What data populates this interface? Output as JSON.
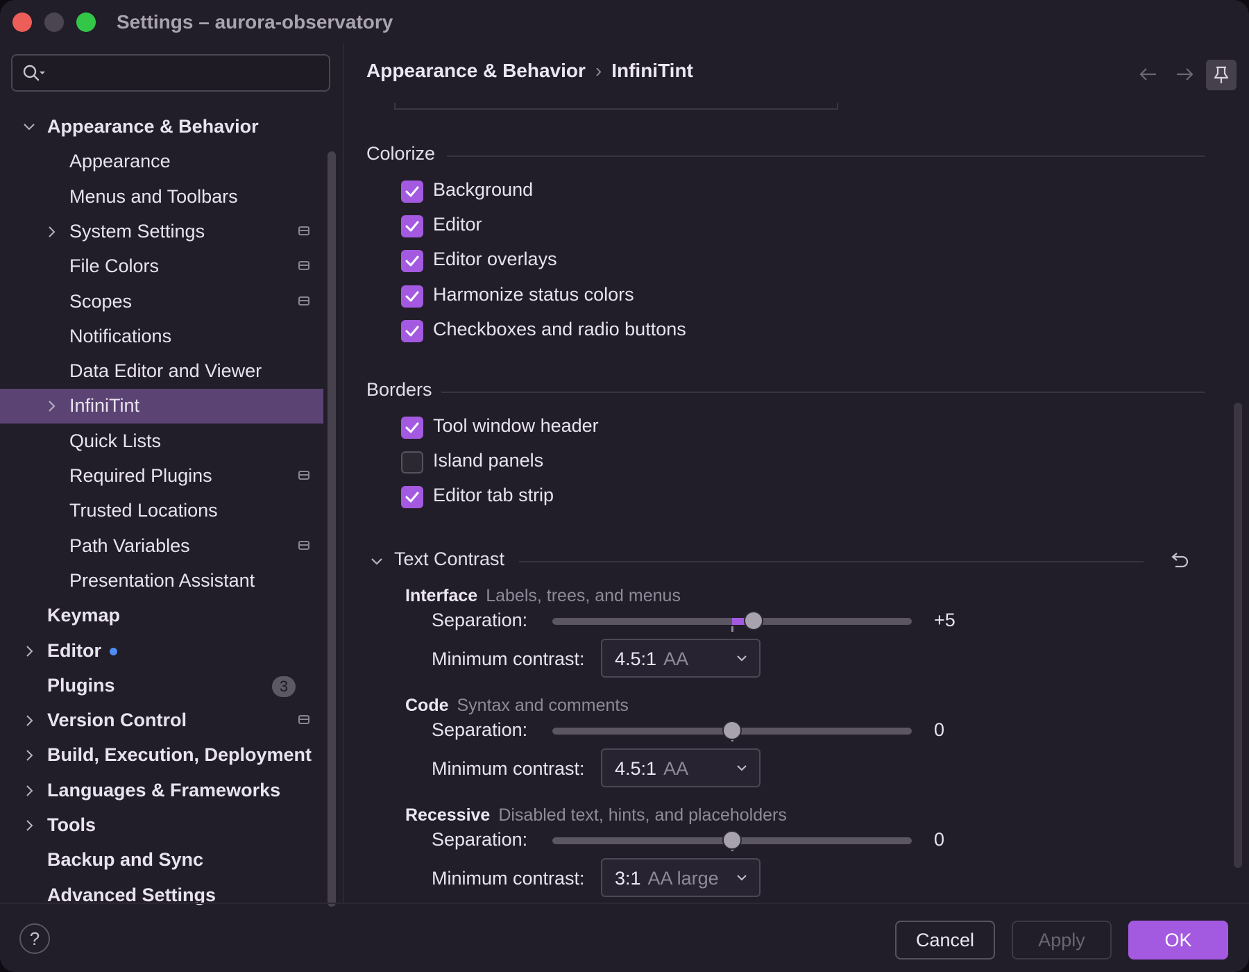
{
  "window": {
    "title": "Settings – aurora-observatory"
  },
  "search": {
    "placeholder": ""
  },
  "sidebar": {
    "items": [
      {
        "label": "Appearance & Behavior",
        "level": 0,
        "bold": true,
        "expanded": true
      },
      {
        "label": "Appearance",
        "level": 1
      },
      {
        "label": "Menus and Toolbars",
        "level": 1
      },
      {
        "label": "System Settings",
        "level": 1,
        "collapsed": true,
        "project_icon": true
      },
      {
        "label": "File Colors",
        "level": 1,
        "project_icon": true
      },
      {
        "label": "Scopes",
        "level": 1,
        "project_icon": true
      },
      {
        "label": "Notifications",
        "level": 1
      },
      {
        "label": "Data Editor and Viewer",
        "level": 1
      },
      {
        "label": "InfiniTint",
        "level": 1,
        "collapsed": true,
        "selected": true
      },
      {
        "label": "Quick Lists",
        "level": 1
      },
      {
        "label": "Required Plugins",
        "level": 1,
        "project_icon": true
      },
      {
        "label": "Trusted Locations",
        "level": 1
      },
      {
        "label": "Path Variables",
        "level": 1,
        "project_icon": true
      },
      {
        "label": "Presentation Assistant",
        "level": 1
      },
      {
        "label": "Keymap",
        "level": 0,
        "bold": true
      },
      {
        "label": "Editor",
        "level": 0,
        "bold": true,
        "collapsed": true,
        "modified_dot": true
      },
      {
        "label": "Plugins",
        "level": 0,
        "bold": true,
        "badge": "3"
      },
      {
        "label": "Version Control",
        "level": 0,
        "bold": true,
        "collapsed": true,
        "project_icon": true
      },
      {
        "label": "Build, Execution, Deployment",
        "level": 0,
        "bold": true,
        "collapsed": true
      },
      {
        "label": "Languages & Frameworks",
        "level": 0,
        "bold": true,
        "collapsed": true
      },
      {
        "label": "Tools",
        "level": 0,
        "bold": true,
        "collapsed": true
      },
      {
        "label": "Backup and Sync",
        "level": 0,
        "bold": true
      },
      {
        "label": "Advanced Settings",
        "level": 0,
        "bold": true
      }
    ]
  },
  "breadcrumb": {
    "parent": "Appearance & Behavior",
    "separator": "›",
    "current": "InfiniTint"
  },
  "colorize": {
    "title": "Colorize",
    "options": [
      {
        "label": "Background",
        "checked": true
      },
      {
        "label": "Editor",
        "checked": true
      },
      {
        "label": "Editor overlays",
        "checked": true
      },
      {
        "label": "Harmonize status colors",
        "checked": true
      },
      {
        "label": "Checkboxes and radio buttons",
        "checked": true
      }
    ]
  },
  "borders": {
    "title": "Borders",
    "options": [
      {
        "label": "Tool window header",
        "checked": true
      },
      {
        "label": "Island panels",
        "checked": false
      },
      {
        "label": "Editor tab strip",
        "checked": true
      }
    ]
  },
  "text_contrast": {
    "title": "Text Contrast",
    "groups": [
      {
        "name": "Interface",
        "description": "Labels, trees, and menus",
        "separation_label": "Separation:",
        "separation_value": "+5",
        "separation_fraction": 0.56,
        "min_contrast_label": "Minimum contrast:",
        "min_contrast_ratio": "4.5:1",
        "min_contrast_level": "AA"
      },
      {
        "name": "Code",
        "description": "Syntax and comments",
        "separation_label": "Separation:",
        "separation_value": "0",
        "separation_fraction": 0.5,
        "min_contrast_label": "Minimum contrast:",
        "min_contrast_ratio": "4.5:1",
        "min_contrast_level": "AA"
      },
      {
        "name": "Recessive",
        "description": "Disabled text, hints, and placeholders",
        "separation_label": "Separation:",
        "separation_value": "0",
        "separation_fraction": 0.5,
        "min_contrast_label": "Minimum contrast:",
        "min_contrast_ratio": "3:1",
        "min_contrast_level": "AA large"
      }
    ]
  },
  "footer": {
    "help": "?",
    "cancel": "Cancel",
    "apply": "Apply",
    "ok": "OK"
  },
  "colors": {
    "accent": "#a45ae0",
    "selection": "#5b4474",
    "background": "#221e29",
    "modified_dot": "#4f8cf7"
  }
}
